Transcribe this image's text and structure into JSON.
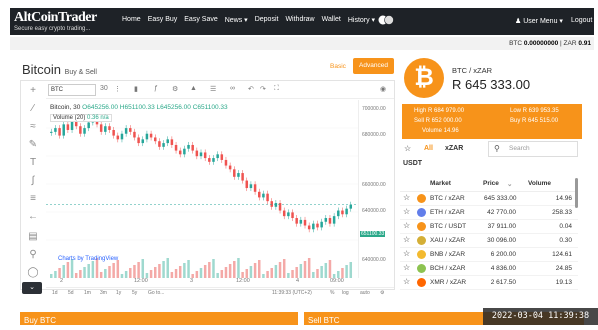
{
  "nav": {
    "logo_main": "AltCoinTrader",
    "logo_tagline": "Secure easy crypto trading...",
    "links": [
      "Home",
      "Easy Buy",
      "Easy Save",
      "News ▾",
      "Deposit",
      "Withdraw",
      "Wallet",
      "History ▾"
    ],
    "user_menu": "User Menu ▾",
    "logout": "Logout"
  },
  "balance": {
    "btc_label": "BTC",
    "btc_value": "0.00000000",
    "zar_label": "ZAR",
    "zar_value": "0.91"
  },
  "page": {
    "title": "Bitcoin",
    "subtitle": "Buy & Sell",
    "basic_label": "Basic",
    "advanced_label": "Advanced"
  },
  "chart_toolbar": {
    "symbol": "BTC",
    "interval": "30"
  },
  "ohlc": {
    "symbol_interval": "Bitcoin, 30",
    "open": "645256.00",
    "high": "651100.33",
    "low": "645256.00",
    "close": "651100.33",
    "volume_label": "Volume (20)",
    "volume_value": "0.36",
    "volume_na": "n/a"
  },
  "price_axis": {
    "labels": [
      "700000.00",
      "680000.00",
      "660000.00",
      "651100.33",
      "640000.00",
      "620000.00",
      "600000.00"
    ],
    "current": "651100.33"
  },
  "time_axis": [
    "2",
    "12:00",
    "3",
    "12:00",
    "4",
    "09:00"
  ],
  "bottom_bar": {
    "ranges": [
      "1d",
      "5d",
      "1m",
      "3m",
      "1y",
      "5y",
      "Go to..."
    ],
    "clock": "11:39:33 (UTC+2)",
    "pct": "%",
    "log": "log",
    "auto": "auto"
  },
  "watermark": "Charts by TradingView",
  "chart_data": {
    "type": "candlestick",
    "x_ticks": [
      "2",
      "12:00",
      "3",
      "12:00",
      "4",
      "09:00"
    ],
    "y_ticks": [
      600000,
      620000,
      640000,
      660000,
      680000,
      700000
    ],
    "ylim": [
      628000,
      707000
    ],
    "last_price": 651100.33,
    "series": [
      {
        "name": "Bitcoin, 30",
        "values": [
          690000,
          692000,
          688000,
          694000,
          691000,
          696000,
          693000,
          689000,
          692000,
          695000,
          697000,
          694000,
          690000,
          693000,
          691000,
          688000,
          686000,
          689000,
          692000,
          690000,
          687000,
          684000,
          686000,
          689000,
          687000,
          685000,
          682000,
          684000,
          686000,
          683000,
          680000,
          678000,
          681000,
          683000,
          680000,
          677000,
          679000,
          676000,
          674000,
          676000,
          678000,
          675000,
          672000,
          670000,
          666000,
          668000,
          664000,
          660000,
          662000,
          658000,
          655000,
          657000,
          653000,
          650000,
          652000,
          648000,
          645000,
          647000,
          644000,
          641000,
          643000,
          640000,
          638000,
          641000,
          639000,
          642000,
          644000,
          641000,
          645000,
          648000,
          646000,
          649000,
          651100
        ]
      }
    ]
  },
  "ticker": {
    "pair": "BTC / xZAR",
    "price": "R 645 333.00",
    "high": "High R 684 979.00",
    "low": "Low R 639 953.35",
    "sell": "Sell R 652 000.00",
    "buy": "Buy R 645 515.00",
    "volume": "Volume 14.96"
  },
  "market_tabs": {
    "all": "All",
    "xzar": "xZAR",
    "usdt": "USDT",
    "search_placeholder": "Search"
  },
  "market_table": {
    "headers": [
      "Market",
      "Price",
      "Volume"
    ],
    "rows": [
      {
        "market": "BTC / xZAR",
        "price": "645 333.00",
        "volume": "14.96",
        "color": "#f7931a"
      },
      {
        "market": "ETH / xZAR",
        "price": "42 770.00",
        "volume": "258.33",
        "color": "#627eea"
      },
      {
        "market": "BTC / USDT",
        "price": "37 911.00",
        "volume": "0.04",
        "color": "#f7931a"
      },
      {
        "market": "XAU / xZAR",
        "price": "30 096.00",
        "volume": "0.30",
        "color": "#d4af37"
      },
      {
        "market": "BNB / xZAR",
        "price": "6 200.00",
        "volume": "124.61",
        "color": "#f3ba2f"
      },
      {
        "market": "BCH / xZAR",
        "price": "4 836.00",
        "volume": "24.85",
        "color": "#8dc351"
      },
      {
        "market": "XMR / xZAR",
        "price": "2 617.50",
        "volume": "19.13",
        "color": "#ff6600"
      }
    ]
  },
  "sections": {
    "buy": "Buy BTC",
    "sell": "Sell BTC"
  },
  "timestamp": "2022-03-04 11:39:38"
}
